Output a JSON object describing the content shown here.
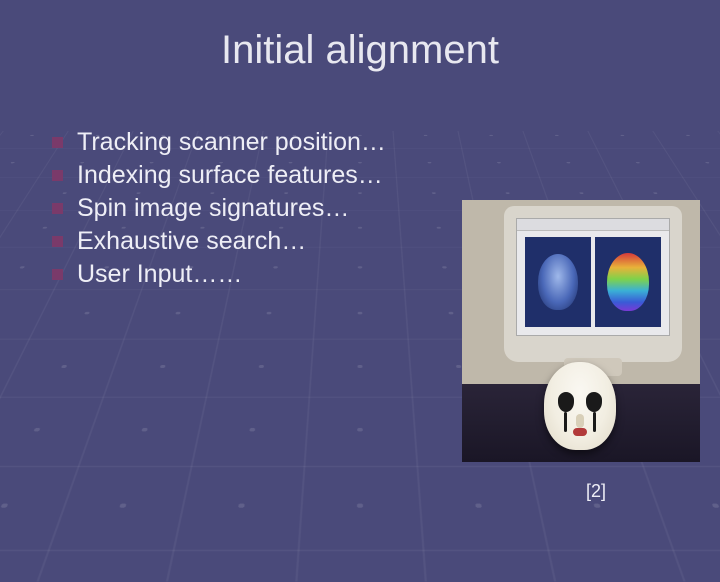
{
  "title": "Initial alignment",
  "bullets": [
    "Tracking scanner position…",
    "Indexing surface features…",
    "Spin image signatures…",
    "Exhaustive search…",
    "User Input……"
  ],
  "citation": "[2]"
}
